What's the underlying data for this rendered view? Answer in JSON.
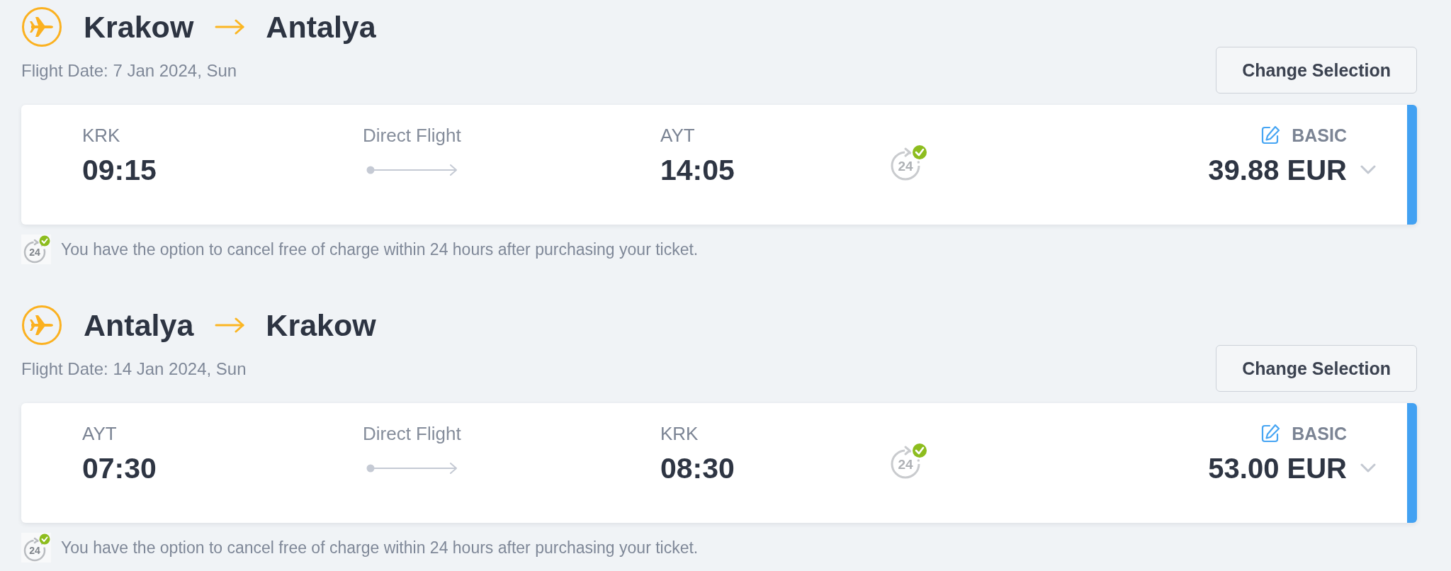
{
  "flights": [
    {
      "origin": "Krakow",
      "destination": "Antalya",
      "flight_date": "Flight Date: 7 Jan 2024, Sun",
      "change_button": "Change Selection",
      "selected": true,
      "departure": {
        "code": "KRK",
        "time": "09:15"
      },
      "stops": "Direct Flight",
      "arrival": {
        "code": "AYT",
        "time": "14:05"
      },
      "cancel_icon_label": "24",
      "fare": {
        "name": "BASIC",
        "price": "39.88 EUR",
        "expanded": false
      },
      "note": {
        "icon_label": "24",
        "text": "You have the option to cancel free of charge within 24 hours after purchasing your ticket."
      }
    },
    {
      "origin": "Antalya",
      "destination": "Krakow",
      "flight_date": "Flight Date: 14 Jan 2024, Sun",
      "change_button": "Change Selection",
      "selected": true,
      "departure": {
        "code": "AYT",
        "time": "07:30"
      },
      "stops": "Direct Flight",
      "arrival": {
        "code": "KRK",
        "time": "08:30"
      },
      "cancel_icon_label": "24",
      "fare": {
        "name": "BASIC",
        "price": "53.00 EUR",
        "expanded": false
      },
      "note": {
        "icon_label": "24",
        "text": "You have the option to cancel free of charge within 24 hours after purchasing your ticket."
      }
    }
  ]
}
